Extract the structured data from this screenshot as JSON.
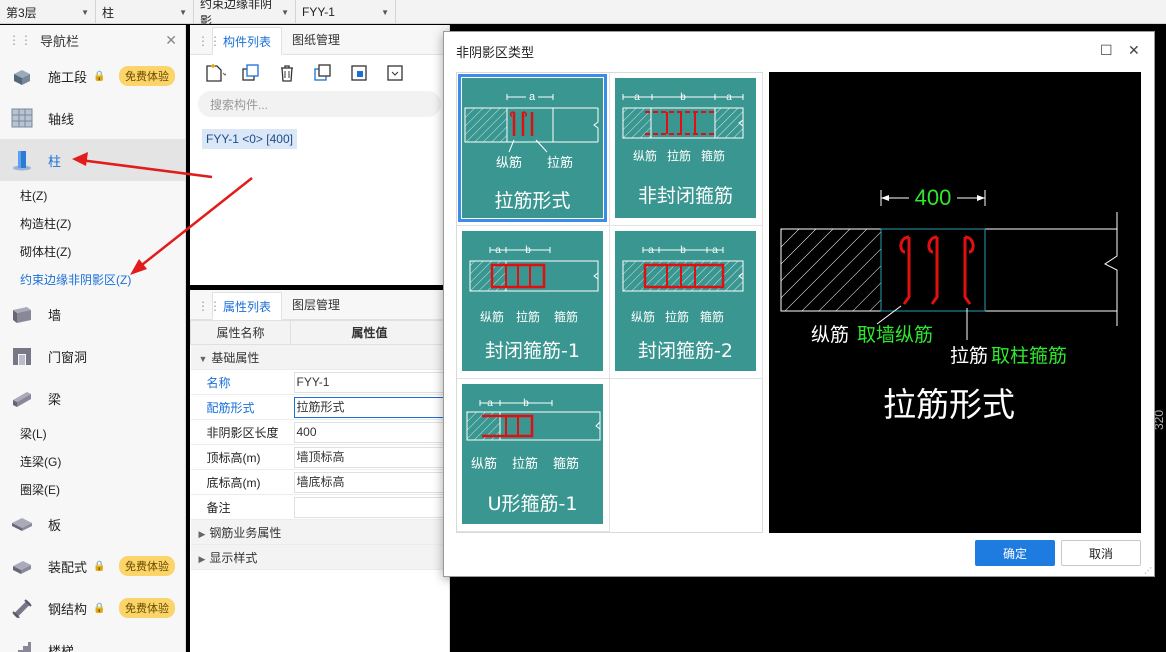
{
  "topbar": {
    "floor": "第3层",
    "category": "柱",
    "subtype": "约束边缘非阴影",
    "component": "FYY-1"
  },
  "nav": {
    "title": "导航栏",
    "cats": [
      {
        "label": "施工段",
        "badge": "免费体验"
      },
      {
        "label": "轴线"
      },
      {
        "label": "柱"
      },
      {
        "label": "墙"
      },
      {
        "label": "门窗洞"
      },
      {
        "label": "梁"
      },
      {
        "label": "板"
      },
      {
        "label": "装配式",
        "badge": "免费体验"
      },
      {
        "label": "钢结构",
        "badge": "免费体验"
      },
      {
        "label": "楼梯"
      }
    ],
    "col_subs": [
      "柱(Z)",
      "构造柱(Z)",
      "砌体柱(Z)",
      "约束边缘非阴影区(Z)"
    ],
    "beam_subs": [
      "梁(L)",
      "连梁(G)",
      "圈梁(E)"
    ]
  },
  "comp_panel": {
    "tab_list": "构件列表",
    "tab_drawings": "图纸管理",
    "search_placeholder": "搜索构件...",
    "item": "FYY-1 <0> [400]"
  },
  "props": {
    "tab_props": "属性列表",
    "tab_layers": "图层管理",
    "col_name": "属性名称",
    "col_value": "属性值",
    "group_basic": "基础属性",
    "rows": [
      {
        "k": "名称",
        "v": "FYY-1"
      },
      {
        "k": "配筋形式",
        "v": "拉筋形式"
      },
      {
        "k": "非阴影区长度",
        "v": "400"
      },
      {
        "k": "顶标高(m)",
        "v": "墙顶标高"
      },
      {
        "k": "底标高(m)",
        "v": "墙底标高"
      },
      {
        "k": "备注",
        "v": ""
      }
    ],
    "group_rebar": "钢筋业务属性",
    "group_display": "显示样式"
  },
  "cad": {
    "edge_number": "320"
  },
  "dialog": {
    "title": "非阴影区类型",
    "tiles": [
      {
        "label": "拉筋形式",
        "t1": "纵筋",
        "t2": "拉筋",
        "dim": "a"
      },
      {
        "label": "非封闭箍筋",
        "t1": "纵筋",
        "t2": "拉筋",
        "t3": "箍筋",
        "da": "a",
        "db": "b"
      },
      {
        "label": "封闭箍筋-1",
        "t1": "纵筋",
        "t2": "拉筋",
        "t3": "箍筋",
        "da": "a",
        "db": "b"
      },
      {
        "label": "封闭箍筋-2",
        "t1": "纵筋",
        "t2": "拉筋",
        "t3": "箍筋",
        "da": "a",
        "db": "b"
      },
      {
        "label": "U形箍筋-1",
        "t1": "纵筋",
        "t2": "拉筋",
        "t3": "箍筋",
        "da": "a",
        "db": "b"
      }
    ],
    "preview": {
      "dim": "400",
      "t1": "纵筋",
      "t1b": "取墙纵筋",
      "t2": "拉筋",
      "t2b": "取柱箍筋",
      "big": "拉筋形式"
    },
    "ok": "确定",
    "cancel": "取消"
  }
}
